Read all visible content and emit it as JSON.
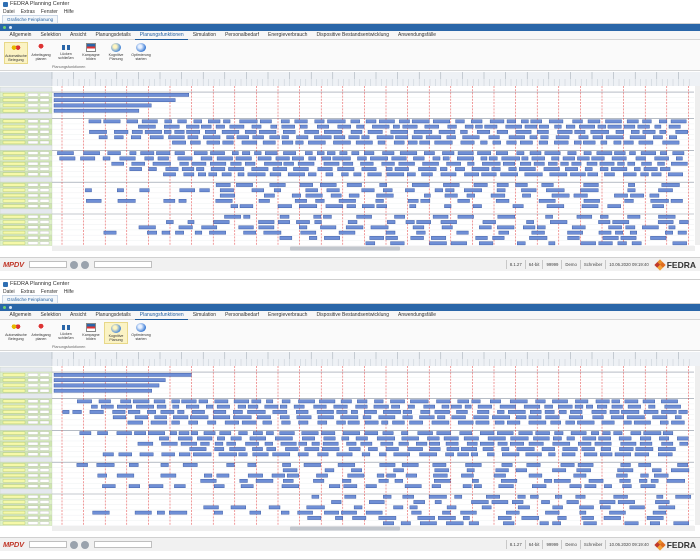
{
  "windows": [
    {
      "title": "FEDRA Planning Center",
      "menu": [
        "Datei",
        "Extras",
        "Fenster",
        "Hilfe"
      ],
      "doc_tab": "Grafische Feinplanung",
      "ribbon_tabs": [
        "Allgemein",
        "Selektion",
        "Ansicht",
        "Planungsdetails",
        "Planungsfunktionen",
        "Simulation",
        "Personalbedarf",
        "Energieverbrauch",
        "Dispositive Bestandsentwicklung",
        "Anwendungsfälle"
      ],
      "active_ribbon_tab": "Planungsfunktionen",
      "ribbon_buttons": [
        {
          "label": "Automatische Belegung",
          "icon": "pins-icon",
          "highlighted": true
        },
        {
          "label": "Arbeitsgang planen",
          "icon": "pin-red-icon",
          "highlighted": false
        },
        {
          "label": "Lücken schließen",
          "icon": "link-icon",
          "highlighted": false
        },
        {
          "label": "Kampagne bilden",
          "icon": "flag-icon",
          "highlighted": false
        },
        {
          "label": "Kognitive Planung",
          "icon": "globe-icon",
          "highlighted": false
        },
        {
          "label": "Optimierung starten",
          "icon": "globe-icon",
          "highlighted": false
        }
      ],
      "ribbon_group_label": "Planungsfunktionen",
      "status": {
        "left_label": "",
        "version": "8.1.27",
        "arch": "64-bit",
        "port": "99999",
        "mode": "Demo",
        "user": "Schreiber",
        "datetime": "10.06.2020 09:19:40"
      }
    },
    {
      "title": "FEDRA Planning Center",
      "menu": [
        "Datei",
        "Extras",
        "Fenster",
        "Hilfe"
      ],
      "doc_tab": "Grafische Feinplanung",
      "ribbon_tabs": [
        "Allgemein",
        "Selektion",
        "Ansicht",
        "Planungsdetails",
        "Planungsfunktionen",
        "Simulation",
        "Personalbedarf",
        "Energieverbrauch",
        "Dispositive Bestandsentwicklung",
        "Anwendungsfälle"
      ],
      "active_ribbon_tab": "Planungsfunktionen",
      "ribbon_buttons": [
        {
          "label": "Automatische Belegung",
          "icon": "pins-icon",
          "highlighted": false
        },
        {
          "label": "Arbeitsgang planen",
          "icon": "pin-red-icon",
          "highlighted": false
        },
        {
          "label": "Lücken schließen",
          "icon": "link-icon",
          "highlighted": false
        },
        {
          "label": "Kampagne bilden",
          "icon": "flag-icon",
          "highlighted": false
        },
        {
          "label": "Kognitive Planung",
          "icon": "globe-icon",
          "highlighted": true
        },
        {
          "label": "Optimierung starten",
          "icon": "globe-icon",
          "highlighted": false
        }
      ],
      "ribbon_group_label": "Planungsfunktionen",
      "status": {
        "left_label": "",
        "version": "8.1.27",
        "arch": "64-bit",
        "port": "99999",
        "mode": "Demo",
        "user": "Schreiber",
        "datetime": "10.06.2020 09:19:40"
      }
    }
  ],
  "brand": {
    "mpdv_logo": "MPDV",
    "fedra_logo": "FEDRA"
  },
  "colors": {
    "accent": "#2a66a8",
    "bar_fill": "#6f8fd6",
    "bar_stroke": "#2f4f9a",
    "shift_line": "#e33b3b",
    "resource_row": "#dff2c8",
    "resource_row_alt": "#cfe7b0"
  }
}
